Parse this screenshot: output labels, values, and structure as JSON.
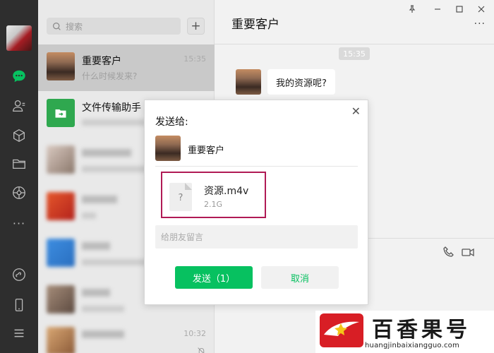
{
  "search": {
    "placeholder": "搜索"
  },
  "chats": [
    {
      "name": "重要客户",
      "preview": "什么时候发来?",
      "time": "15:35",
      "active": true
    },
    {
      "name": "文件传输助手",
      "preview": "",
      "time": ""
    },
    {
      "name": "",
      "preview": "",
      "time": ""
    },
    {
      "name": "",
      "preview": "",
      "time": ""
    },
    {
      "name": "",
      "preview": "",
      "time": ""
    },
    {
      "name": "",
      "preview": "",
      "time": ""
    },
    {
      "name": "",
      "preview": "",
      "time": "10:32"
    }
  ],
  "conversation": {
    "title": "重要客户",
    "timestamp": "15:35",
    "message": "我的资源呢?"
  },
  "dialog": {
    "send_to_label": "发送给:",
    "recipient": "重要客户",
    "file_name": "资源.m4v",
    "file_size": "2.1G",
    "file_icon_glyph": "?",
    "message_placeholder": "给朋友留言",
    "send_label": "发送（1）",
    "cancel_label": "取消"
  },
  "watermark": {
    "brand_cn": "百香果号",
    "url": "huangjinbaixiangguo.com"
  },
  "colors": {
    "accent_green": "#07c160",
    "highlight_border": "#b01a55",
    "rail_bg": "#2e2e2e"
  }
}
